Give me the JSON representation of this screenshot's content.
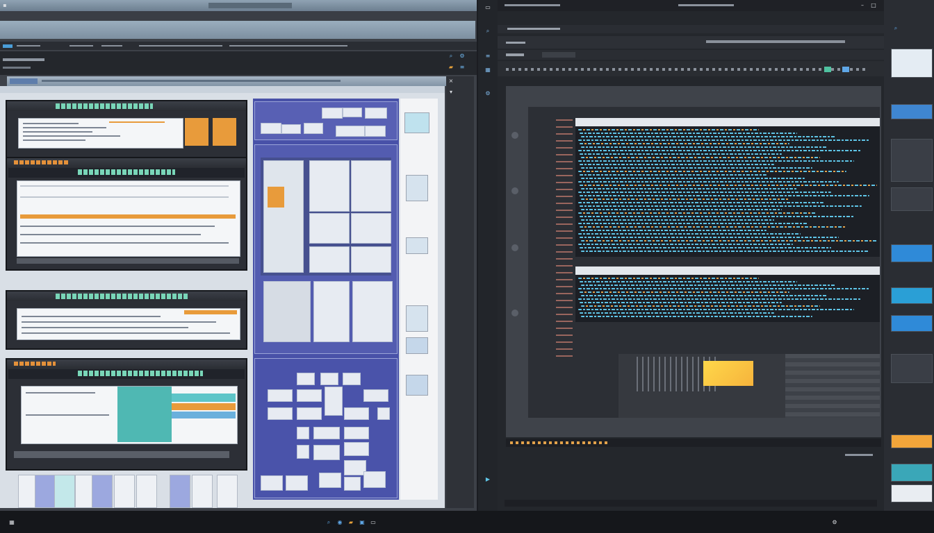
{
  "colors": {
    "accent_orange": "#e89b3b",
    "accent_teal": "#4fb8b3",
    "panel_blue": "#4851a8",
    "code_cyan": "#5fc4e6",
    "code_orange": "#e3a24a",
    "highlight_yellow": "#ffd84a"
  },
  "icons": [
    "window-icon",
    "minimize-icon",
    "maximize-icon",
    "close-icon",
    "folder-icon",
    "search-icon",
    "gear-icon",
    "layers-icon",
    "grid-icon",
    "play-icon",
    "chevron-down-icon"
  ],
  "taskbar": {
    "icons": [
      "start-icon",
      "search-icon",
      "browser-icon",
      "folder-icon",
      "editor-icon",
      "terminal-icon",
      "settings-icon"
    ]
  }
}
